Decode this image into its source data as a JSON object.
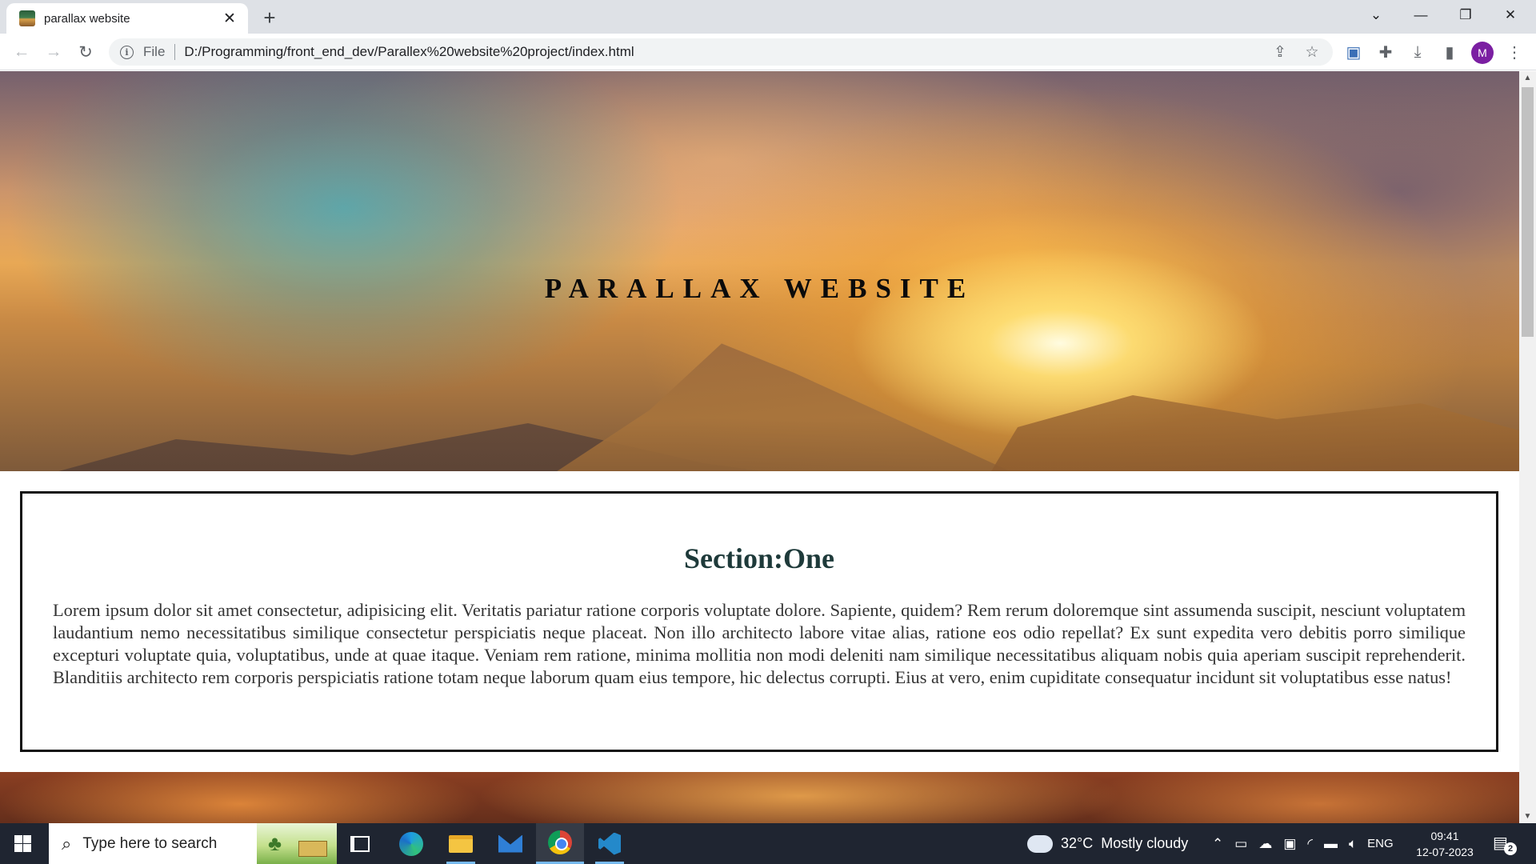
{
  "browser": {
    "tab_title": "parallax website",
    "tab_close_icon": "close-icon",
    "new_tab_label": "+",
    "window_controls": [
      "chevron-down-icon",
      "minimize-icon",
      "restore-icon",
      "close-icon"
    ],
    "address": {
      "scheme_label": "File",
      "url": "D:/Programming/front_end_dev/Parallex%20website%20project/index.html"
    },
    "profile_initial": "M"
  },
  "page": {
    "hero_title": "PARALLAX WEBSITE",
    "section_title": "Section:One",
    "section_text": "Lorem ipsum dolor sit amet consectetur, adipisicing elit. Veritatis pariatur ratione corporis voluptate dolore. Sapiente, quidem? Rem rerum doloremque sint assumenda suscipit, nesciunt voluptatem laudantium nemo necessitatibus similique consectetur perspiciatis neque placeat. Non illo architecto labore vitae alias, ratione eos odio repellat? Ex sunt expedita vero debitis porro similique excepturi voluptate quia, voluptatibus, unde at quae itaque. Veniam rem ratione, minima mollitia non modi deleniti nam similique necessitatibus aliquam nobis quia aperiam suscipit reprehenderit. Blanditiis architecto rem corporis perspiciatis ratione totam neque laborum quam eius tempore, hic delectus corrupti. Eius at vero, enim cupiditate consequatur incidunt sit voluptatibus esse natus!"
  },
  "taskbar": {
    "search_placeholder": "Type here to search",
    "weather": {
      "temp": "32°C",
      "condition": "Mostly cloudy"
    },
    "language": "ENG",
    "time": "09:41",
    "date": "12-07-2023",
    "notification_count": "2",
    "pinned": [
      "task-view-icon",
      "edge-icon",
      "file-explorer-icon",
      "mail-icon",
      "chrome-icon",
      "vscode-icon"
    ]
  },
  "colors": {
    "section_title": "#1e3a3a",
    "profile_avatar": "#7b1fa2",
    "taskbar": "#1f2531"
  }
}
